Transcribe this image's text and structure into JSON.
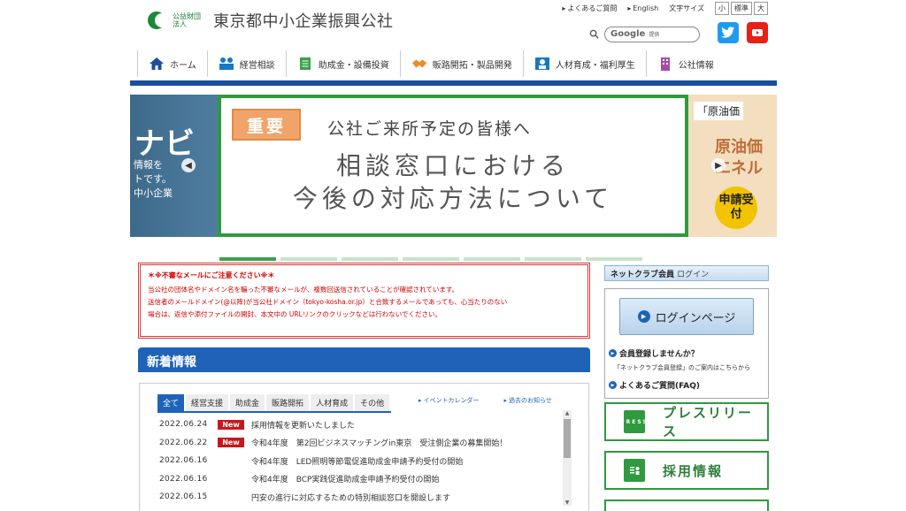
{
  "header": {
    "logo_small": "公益財団法人",
    "logo_text": "東京都中小企業振興公社",
    "util_links": [
      "よくあるご質問",
      "English"
    ],
    "font_size_label": "文字サイズ",
    "font_sizes": [
      "小",
      "標準",
      "大"
    ],
    "search_brand": "Google",
    "search_sub": "提供"
  },
  "nav": [
    {
      "label": "ホーム",
      "icon": "home-icon"
    },
    {
      "label": "経営相談",
      "icon": "consult-icon"
    },
    {
      "label": "助成金・設備投資",
      "icon": "document-icon"
    },
    {
      "label": "販路開拓・製品開発",
      "icon": "handshake-icon"
    },
    {
      "label": "人材育成・福利厚生",
      "icon": "people-icon"
    },
    {
      "label": "公社情報",
      "icon": "building-icon"
    }
  ],
  "carousel": {
    "left_big": "ナビ",
    "left_lines": [
      "情報を",
      "トです。",
      "中小企業"
    ],
    "badge": "重要",
    "sub": "公社ご来所予定の皆様へ",
    "title_line1": "相談窓口における",
    "title_line2": "今後の対応方法について",
    "right_title": "「原油価",
    "right_lines": [
      "原油価",
      "エネル"
    ],
    "right_badge": "申請受付"
  },
  "warning": {
    "title": "＊※不審なメールにご注意ください※＊",
    "lines": [
      "当公社の団体名やドメイン名を騙った不審なメールが、複数回送信されていることが確認されています。",
      "送信者のメールドメイン(@以降)が当公社ドメイン（tokyo-kosha.or.jp）と合致するメールであっても、心当たりのない",
      "場合は、返信や添付ファイルの開封、本文中の URLリンクのクリックなどは行わないでください。"
    ]
  },
  "news": {
    "heading": "新着情報",
    "tabs": [
      "全て",
      "経営支援",
      "助成金",
      "販路開拓",
      "人材育成",
      "その他"
    ],
    "links": [
      "イベントカレンダー",
      "過去のお知らせ"
    ],
    "items": [
      {
        "date": "2022.06.24",
        "new": "New",
        "text": "採用情報を更新いたしました"
      },
      {
        "date": "2022.06.22",
        "new": "New",
        "text": "令和4年度　第2回ビジネスマッチングin東京　受注側企業の募集開始！"
      },
      {
        "date": "2022.06.16",
        "new": "",
        "text": "令和4年度　LED照明等節電促進助成金申請予約受付の開始"
      },
      {
        "date": "2022.06.16",
        "new": "",
        "text": "令和4年度　BCP実践促進助成金申請予約受付の開始"
      },
      {
        "date": "2022.06.15",
        "new": "",
        "text": "円安の進行に対応するための特別相談窓口を開設します"
      }
    ]
  },
  "netclub": {
    "head": "ネットクラブ会員",
    "head_sub": "ログイン",
    "login": "ログインページ",
    "register_q": "会員登録しませんか？",
    "register_note": "「ネットクラブ会員登録」のご案内はこちらから",
    "faq": "よくあるご質問(FAQ)"
  },
  "side_buttons": {
    "press": "プレスリリース",
    "press_icon_text": "PRESS",
    "recruit": "採用情報"
  },
  "colors": {
    "nav_bar": "#1a4f9c",
    "green": "#2f9a3e",
    "news_blue": "#1e63b8",
    "new_badge": "#c9161d",
    "warn_red": "#d10000"
  }
}
